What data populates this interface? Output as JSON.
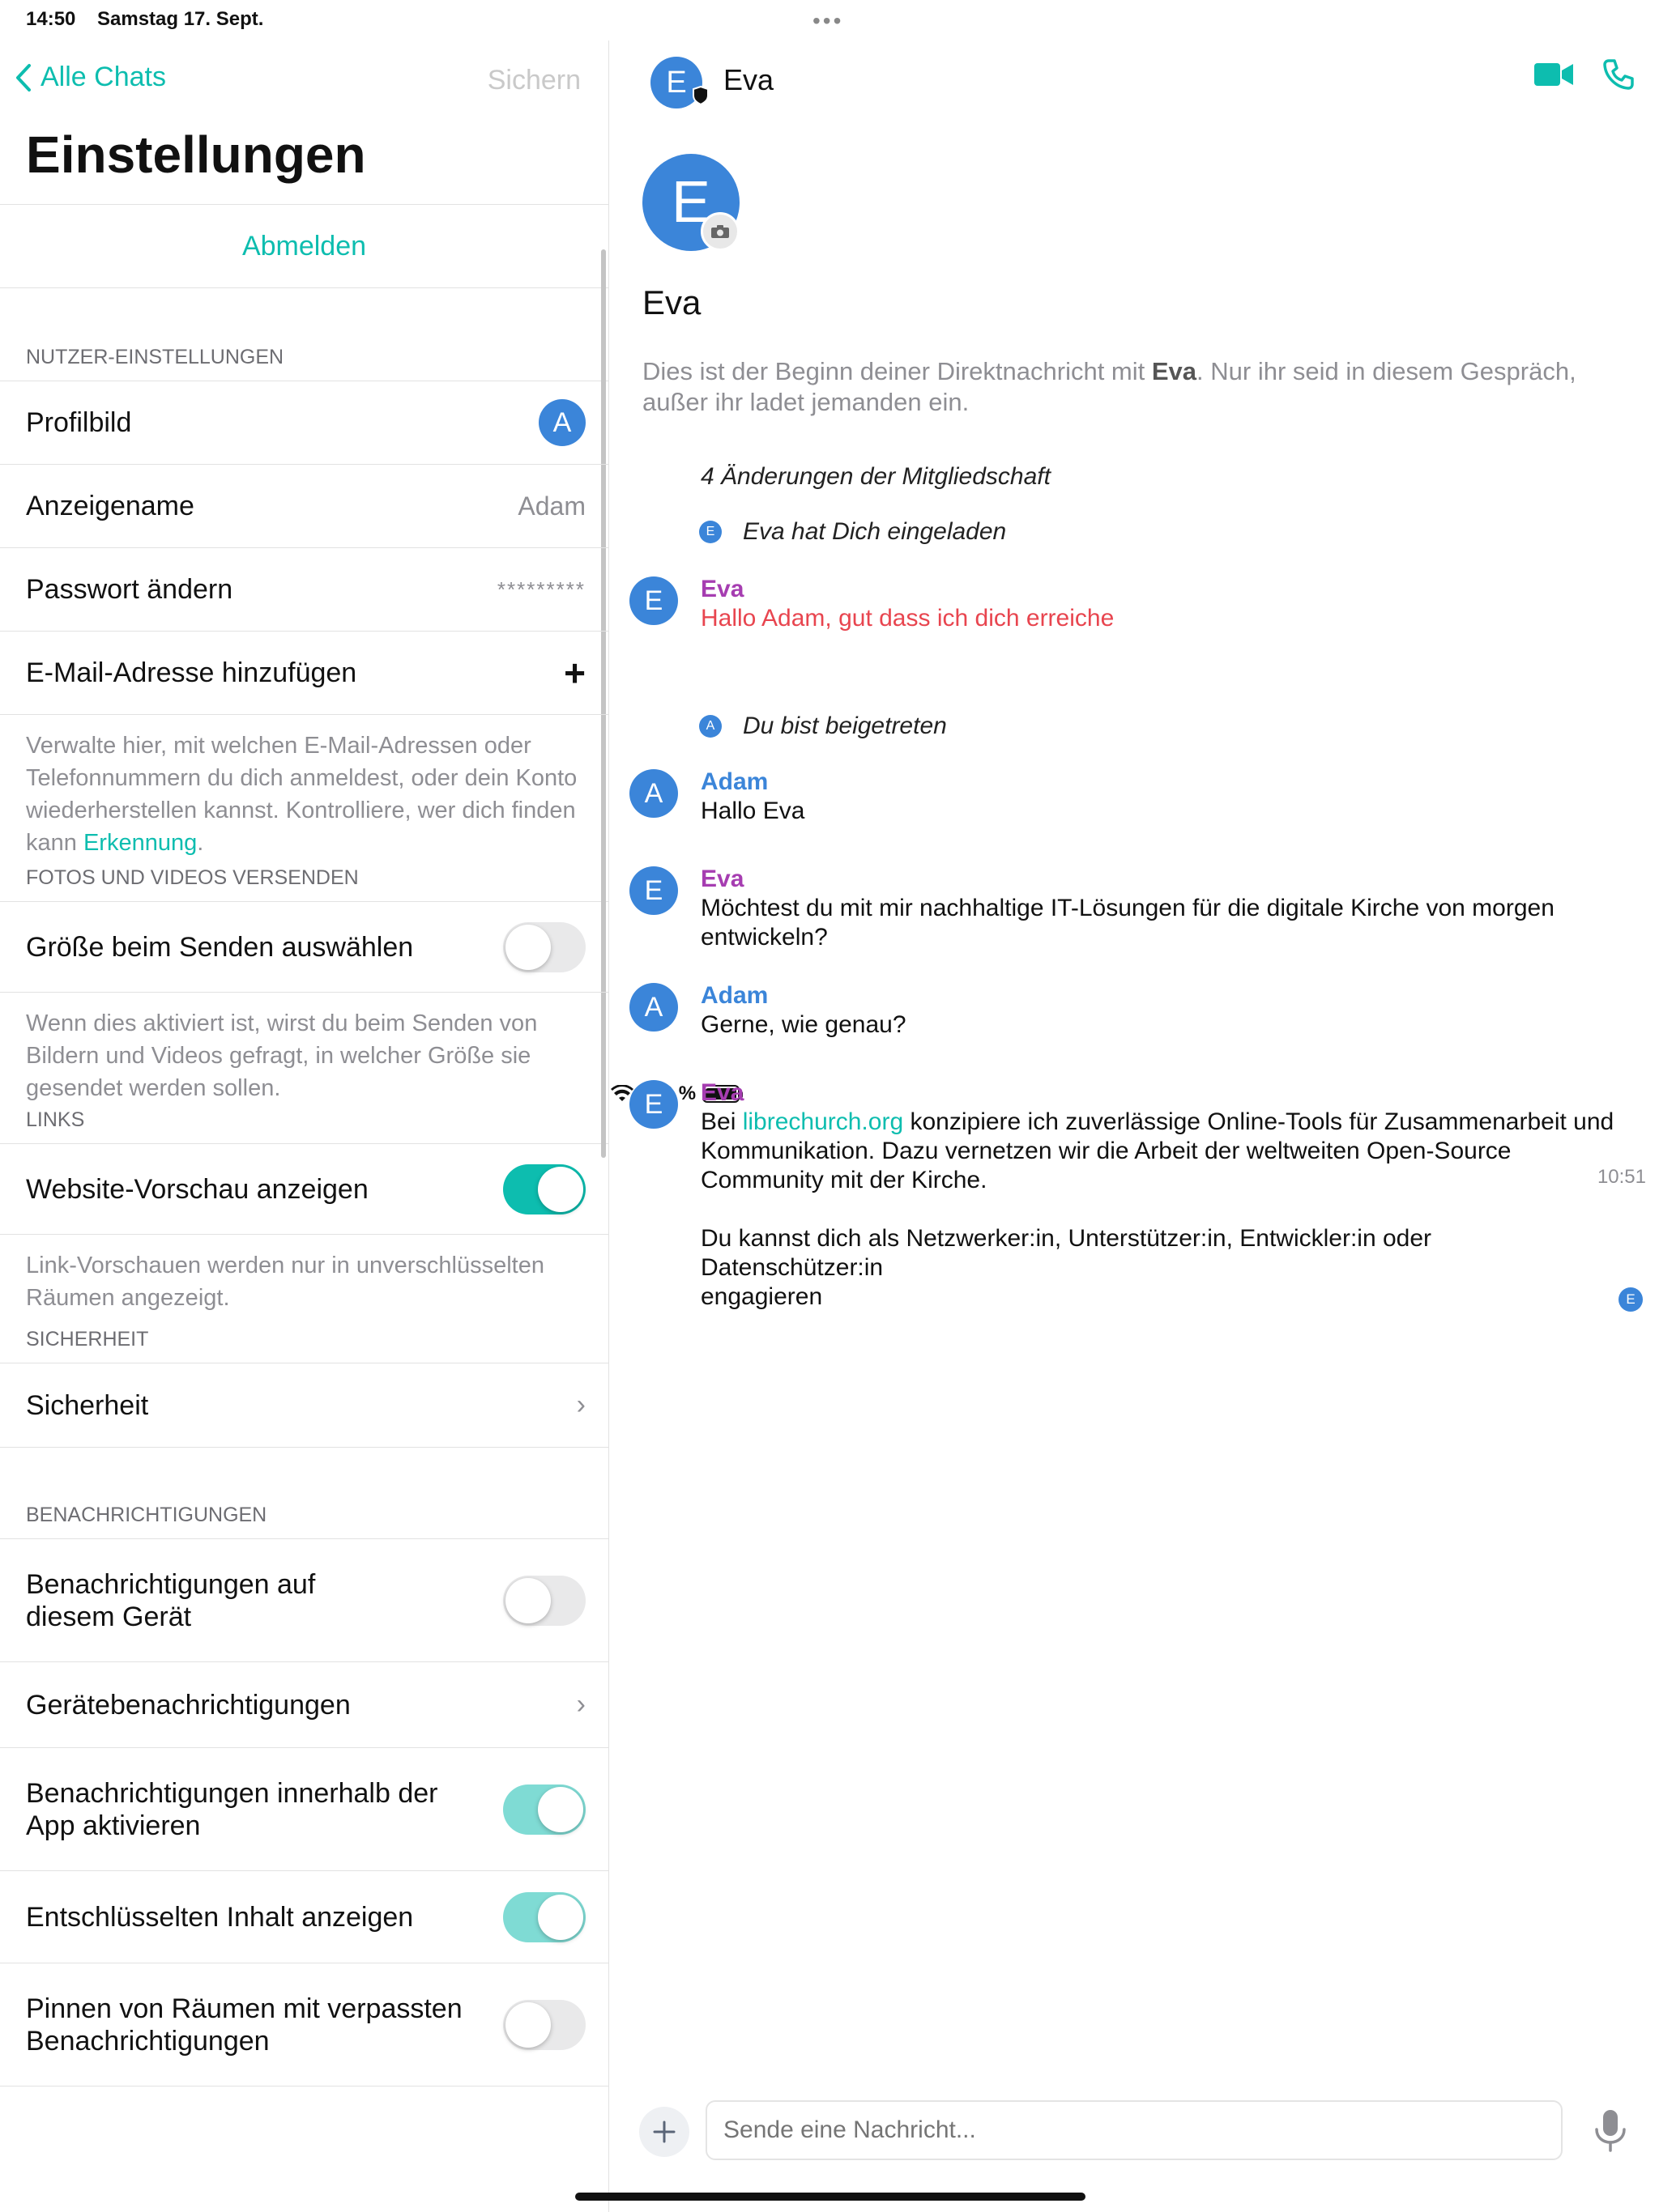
{
  "status": {
    "time": "14:50",
    "date": "Samstag 17. Sept.",
    "battery": "100 %"
  },
  "settings": {
    "back_label": "Alle Chats",
    "save_label": "Sichern",
    "title": "Einstellungen",
    "signout_label": "Abmelden",
    "user_section": {
      "header": "NUTZER-EINSTELLUNGEN",
      "profile_label": "Profilbild",
      "profile_initial": "A",
      "display_name_label": "Anzeigename",
      "display_name_value": "Adam",
      "password_label": "Passwort ändern",
      "password_value": "*********",
      "email_label": "E-Mail-Adresse hinzufügen",
      "footnote": "Verwalte hier, mit welchen E-Mail-Adressen oder Telefonnummern du dich anmeldest, oder dein Konto wiederherstellen kannst. Kontrolliere, wer dich finden kann ",
      "footnote_link": "Erkennung",
      "footnote_end": "."
    },
    "media_section": {
      "header": "FOTOS UND VIDEOS VERSENDEN",
      "size_label": "Größe beim Senden auswählen",
      "size_on": false,
      "footnote": "Wenn dies aktiviert ist, wirst du beim Senden von Bildern und Videos gefragt, in welcher Größe sie gesendet werden sollen."
    },
    "links_section": {
      "header": "LINKS",
      "preview_label": "Website-Vorschau anzeigen",
      "preview_on": true,
      "footnote": "Link-Vorschauen werden nur in unverschlüsselten Räumen angezeigt."
    },
    "security_section": {
      "header": "SICHERHEIT",
      "security_label": "Sicherheit"
    },
    "notifications_section": {
      "header": "BENACHRICHTIGUNGEN",
      "device_label": "Benachrichtigungen auf\ndiesem Gerät",
      "device_on": false,
      "device_notif_label": "Gerätebenachrichtigungen",
      "inapp_label": "Benachrichtigungen innerhalb der\nApp aktivieren",
      "inapp_on": true,
      "decrypted_label": "Entschlüsselten Inhalt anzeigen",
      "decrypted_on": true,
      "pin_label": "Pinnen von Räumen mit verpassten\nBenachrichtigungen",
      "pin_on": false
    }
  },
  "chat": {
    "room_name": "Eva",
    "room_initial": "E",
    "intro_before": "Dies ist der Beginn deiner Direktnachricht mit ",
    "intro_name": "Eva",
    "intro_after": ". Nur ihr seid in diesem Gespräch, außer ihr ladet jemanden ein.",
    "membership_changes": "4 Änderungen der Mitgliedschaft",
    "event_invited": "Eva hat Dich eingeladen",
    "event_invited_initial": "E",
    "event_joined": "Du bist beigetreten",
    "event_joined_initial": "A",
    "messages": [
      {
        "sender": "Eva",
        "initial": "E",
        "body": "Hallo Adam, gut dass ich dich erreiche"
      },
      {
        "sender": "Adam",
        "initial": "A",
        "body": "Hallo Eva"
      },
      {
        "sender": "Eva",
        "initial": "E",
        "body": "Möchtest du mit mir nachhaltige IT-Lösungen für die digitale Kirche von morgen entwickeln?"
      },
      {
        "sender": "Adam",
        "initial": "A",
        "body": "Gerne, wie genau?"
      },
      {
        "sender": "Eva",
        "initial": "E",
        "body_prefix": "Bei ",
        "body_link": "librechurch.org",
        "body_rest": " konzipiere ich zuverlässige Online-Tools für Zusammenarbeit und Kommunikation. Dazu vernetzen wir die Arbeit der weltweiten Open-Source Community mit der Kirche.",
        "body_second": "Du kannst dich als Netzwerker:in, Unterstützer:in, Entwickler:in oder Datenschützer:in\nengagieren"
      }
    ],
    "timestamp": "10:51",
    "read_initial": "E",
    "composer_placeholder": "Sende eine Nachricht..."
  },
  "colors": {
    "accent": "#0dbdaf",
    "avatar": "#3b85d9",
    "eva": "#a63db1",
    "alert": "#e8454f"
  }
}
